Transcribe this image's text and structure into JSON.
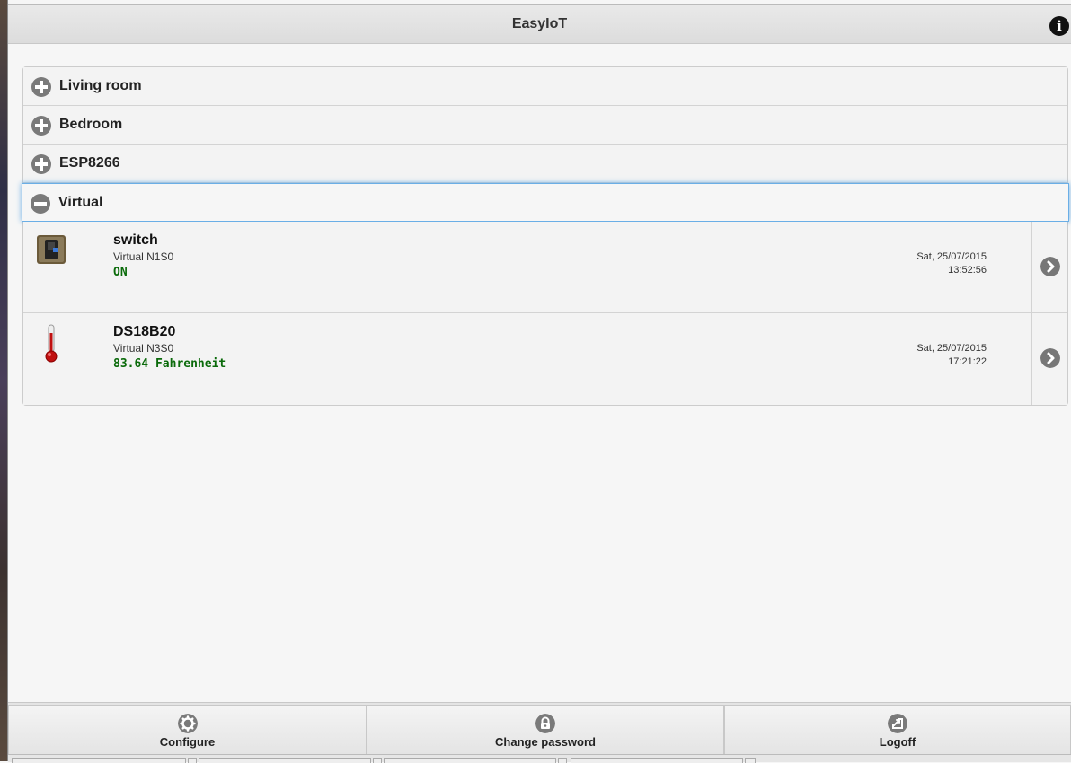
{
  "header": {
    "title": "EasyIoT",
    "info_icon": "info-icon"
  },
  "groups": [
    {
      "label": "Living room",
      "state": "collapsed"
    },
    {
      "label": "Bedroom",
      "state": "collapsed"
    },
    {
      "label": "ESP8266",
      "state": "collapsed"
    },
    {
      "label": "Virtual",
      "state": "expanded"
    }
  ],
  "devices": [
    {
      "name": "switch",
      "node": "Virtual N1S0",
      "status": "ON",
      "date": "Sat, 25/07/2015",
      "time": "13:52:56",
      "icon": "switch-icon"
    },
    {
      "name": "DS18B20",
      "node": "Virtual N3S0",
      "status": "83.64 Fahrenheit",
      "date": "Sat, 25/07/2015",
      "time": "17:21:22",
      "icon": "thermometer-icon"
    }
  ],
  "footer": {
    "configure": "Configure",
    "change_password": "Change password",
    "logoff": "Logoff"
  },
  "colors": {
    "status_text": "#0a6a0a",
    "active_outline": "#6aaee6",
    "icon_gray": "#7a7a7a"
  }
}
